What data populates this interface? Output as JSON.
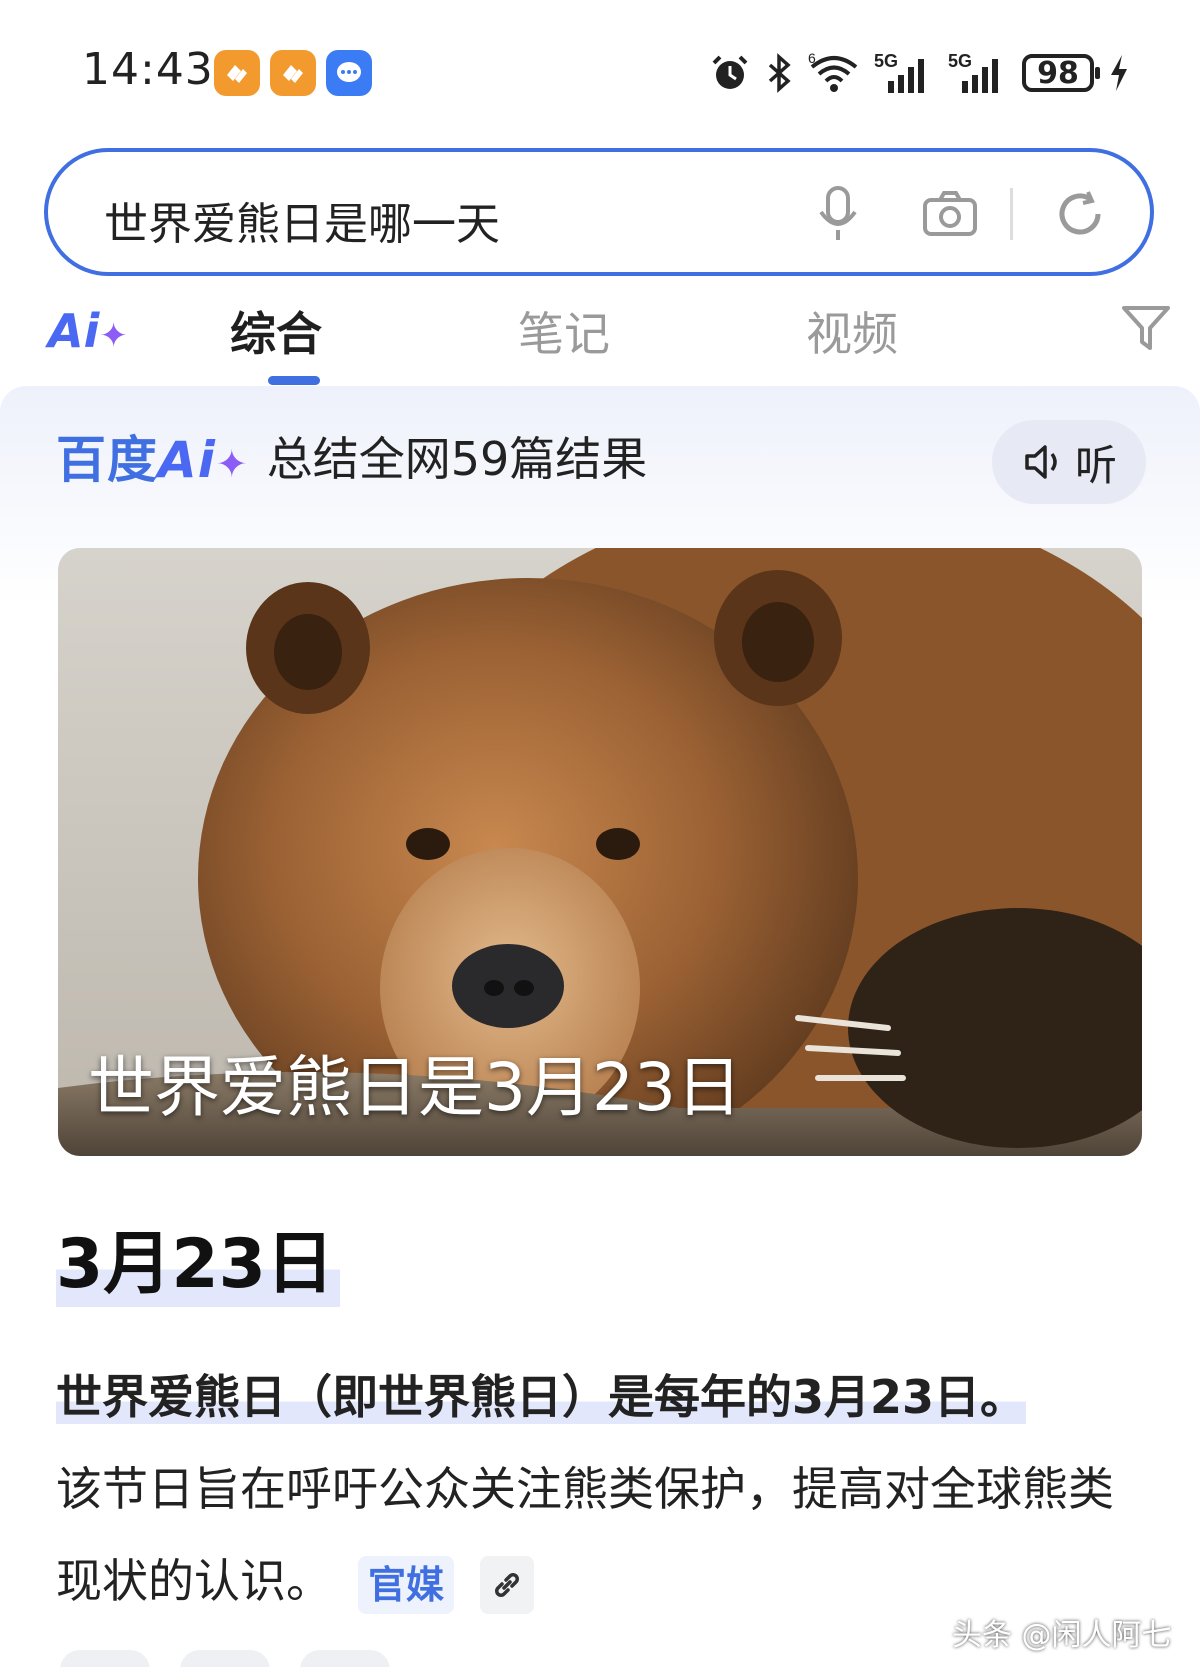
{
  "status_bar": {
    "time": "14:43",
    "battery_level": "98",
    "network_1": "5G",
    "network_2": "5G",
    "icons": [
      "alarm-icon",
      "bluetooth-icon",
      "wifi-icon",
      "signal-icon",
      "signal-icon",
      "charging-icon"
    ]
  },
  "search": {
    "query": "世界爱熊日是哪一天"
  },
  "tabs": {
    "ai_label": "Ai",
    "items": [
      "综合",
      "笔记",
      "视频"
    ],
    "active_index": 0
  },
  "ai_panel": {
    "logo_text": "百度",
    "logo_ai": "Ai",
    "summary": "总结全网59篇结果",
    "listen_label": "听",
    "hero_caption": "世界爱熊日是3月23日",
    "answer_title": "3月23日",
    "answer_highlight": "世界爱熊日（即世界熊日）是每年的3月23日。",
    "answer_rest": "该节日旨在呼吁公众关注熊类保护，提高对全球熊类现状的认识。",
    "source_label": "官媒"
  },
  "watermark": "头条 @闲人阿七",
  "colors": {
    "accent": "#3f6fe0",
    "ai_purple": "#8b5cf6",
    "highlight": "#e3e7fb"
  }
}
